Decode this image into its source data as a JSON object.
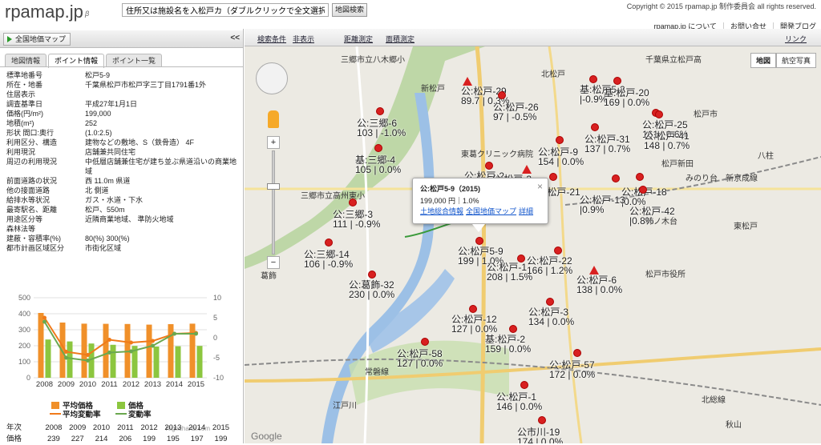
{
  "header": {
    "logo": "rpamap.jp",
    "beta": "β",
    "search_value": "住所又は施設名を入松戸カ（ダブルクリックで全文選択）",
    "search_button": "地図検索",
    "copyright": "Copyright © 2015 rpamap.jp 制作委員会 all rights reserved.",
    "links": [
      "rpamap.jp について",
      "お問い合せ",
      "開発ブログ"
    ]
  },
  "left": {
    "national_map_button": "全国地価マップ",
    "collapse": "<<",
    "tabs": [
      "地図情報",
      "ポイント情報",
      "ポイント一覧"
    ],
    "info_rows": [
      {
        "k": "標準地番号",
        "v": "松戸5-9"
      },
      {
        "k": "所在・地番",
        "v": "千葉県松戸市松戸字三丁目1791番1外"
      },
      {
        "k": "住居表示",
        "v": ""
      },
      {
        "k": "調査基準日",
        "v": "平成27年1月1日"
      },
      {
        "k": "価格(円/m²)",
        "v": "199,000"
      },
      {
        "k": "地積(m²)",
        "v": "252"
      },
      {
        "k": "形状 間口:奥行",
        "v": "(1.0:2.5)"
      },
      {
        "k": "利用区分、構造",
        "v": "建物などの敷地、S（鉄骨造） 4F"
      },
      {
        "k": "利用現況",
        "v": "店舗兼共同住宅"
      },
      {
        "k": "周辺の利用現況",
        "v": "中低層店舗兼住宅が建ち並ぶ県道沿いの商業地域"
      },
      {
        "k": "前面道路の状況",
        "v": "西 11.0m 県道"
      },
      {
        "k": "他の接面道路",
        "v": "北 側道"
      },
      {
        "k": "給排水等状況",
        "v": "ガス・水道・下水"
      },
      {
        "k": "最寄駅名、距離",
        "v": "松戸、550m"
      },
      {
        "k": "用途区分等",
        "v": "近隣商業地域、 準防火地域"
      },
      {
        "k": "森林法等",
        "v": ""
      },
      {
        "k": "建蔽・容積率(%)",
        "v": "80(%) 300(%)"
      },
      {
        "k": "都市計画区域区分",
        "v": "市街化区域"
      }
    ],
    "legend": [
      "平均価格",
      "価格",
      "平均変動率",
      "変動率"
    ],
    "credits": "Highcharts.com",
    "table_headers": [
      "年次",
      "2008",
      "2009",
      "2010",
      "2011",
      "2012",
      "2013",
      "2014",
      "2015"
    ],
    "table_row": [
      "価格",
      "239",
      "227",
      "214",
      "206",
      "199",
      "195",
      "197",
      "199"
    ]
  },
  "chart_data": {
    "type": "bar",
    "categories": [
      "2008",
      "2009",
      "2010",
      "2011",
      "2012",
      "2013",
      "2014",
      "2015"
    ],
    "series": [
      {
        "name": "平均価格",
        "values": [
          405,
          345,
          338,
          337,
          336,
          332,
          335,
          338
        ]
      },
      {
        "name": "価格",
        "values": [
          239,
          227,
          214,
          206,
          199,
          195,
          197,
          199
        ]
      },
      {
        "name": "平均変動率",
        "values": [
          5.0,
          -3.5,
          -4.3,
          -0.5,
          -1.2,
          -0.8,
          1.0,
          1.2
        ]
      },
      {
        "name": "変動率",
        "values": [
          4.0,
          -5.0,
          -5.7,
          -3.7,
          -3.4,
          -2.0,
          1.0,
          1.0
        ]
      }
    ],
    "ylim_left": [
      0,
      500
    ],
    "yticks_left": [
      "0",
      "100",
      "200",
      "300",
      "400",
      "500"
    ],
    "ylim_right": [
      -10,
      10
    ],
    "yticks_right": [
      "-10",
      "-5",
      "0",
      "5",
      "10"
    ],
    "colors": {
      "avg_price": "#f0902a",
      "price": "#8cc63f",
      "avg_rate": "#f07a1a",
      "rate": "#6aa84f"
    }
  },
  "map": {
    "toolbar": [
      "検索条件",
      "非表示",
      "距離測定",
      "面積測定",
      "リンク"
    ],
    "map_types": [
      "地図",
      "航空写真"
    ],
    "popup": {
      "title": "公:松戸5-9（2015)",
      "line": "199,000 円｜1.0%",
      "links": [
        "土地総合情報",
        "全国地価マップ",
        "詳細"
      ]
    },
    "google": "Google",
    "place_labels": [
      "三郷市立八木郷小",
      "北松戸",
      "千葉県立松戸高",
      "松戸市",
      "東葛クリニック病院",
      "新京成線",
      "松戸新田",
      "みのり台",
      "八柱",
      "三郷市立高州東小",
      "柿ノ木台",
      "東松戸",
      "葛飾",
      "常磐線",
      "北総線",
      "秋山",
      "松戸市役所",
      "江戸川",
      "新松戸"
    ],
    "points": [
      {
        "name": "公:松戸-29",
        "sub": "89.7 | 0.3%"
      },
      {
        "name": "基:松戸5-2",
        "sub": "|-0.9%"
      },
      {
        "name": "公:松戸-26",
        "sub": "97 | -0.5%"
      },
      {
        "name": "基:松戸-20",
        "sub": "169 | 0.0%"
      },
      {
        "name": "公:三郷-6",
        "sub": "103 | -1.0%"
      },
      {
        "name": "公:松戸-25",
        "sub": "161 | 0.6%"
      },
      {
        "name": "公:松戸-41",
        "sub": "148 | 0.7%"
      },
      {
        "name": "公:松戸-31",
        "sub": "137 | 0.7%"
      },
      {
        "name": "基:三郷-4",
        "sub": "105 | 0.0%"
      },
      {
        "name": "公:松戸-9",
        "sub": "154 | 0.0%"
      },
      {
        "name": "公:松戸-2",
        "sub": "|-1.3%"
      },
      {
        "name": "公:松戸-3",
        "sub": "|2.0%"
      },
      {
        "name": "公:三郷-3",
        "sub": "111 | -0.9%"
      },
      {
        "name": "公:三郷-14",
        "sub": "106 | -0.9%"
      },
      {
        "name": "公:松戸5-9",
        "sub": "199 | 1.0%"
      },
      {
        "name": "公:松戸-1",
        "sub": "208 | 1.5%"
      },
      {
        "name": "公:松戸-22",
        "sub": "166 | 1.2%"
      },
      {
        "name": "公:松戸-6",
        "sub": "138 | 0.0%"
      },
      {
        "name": "公:葛飾-32",
        "sub": "230 | 0.0%"
      },
      {
        "name": "公:松戸-12",
        "sub": "127 | 0.0%"
      },
      {
        "name": "公:松戸-3",
        "sub": "134 | 0.0%"
      },
      {
        "name": "基:松戸-2",
        "sub": "159 | 0.0%"
      },
      {
        "name": "公:松戸-58",
        "sub": "127 | 0.0%"
      },
      {
        "name": "公:松戸-57",
        "sub": "172 | 0.0%"
      },
      {
        "name": "公:松戸-1",
        "sub": "146 | 0.0%"
      },
      {
        "name": "公市川-19",
        "sub": "174 | 0.0%"
      },
      {
        "name": "公:松戸-21",
        "sub": "|"
      },
      {
        "name": "公:松戸-18",
        "sub": "|0.0%"
      },
      {
        "name": "公:松戸-42",
        "sub": "|0.8%"
      },
      {
        "name": "公:松戸-13",
        "sub": "|0.9%"
      }
    ]
  }
}
